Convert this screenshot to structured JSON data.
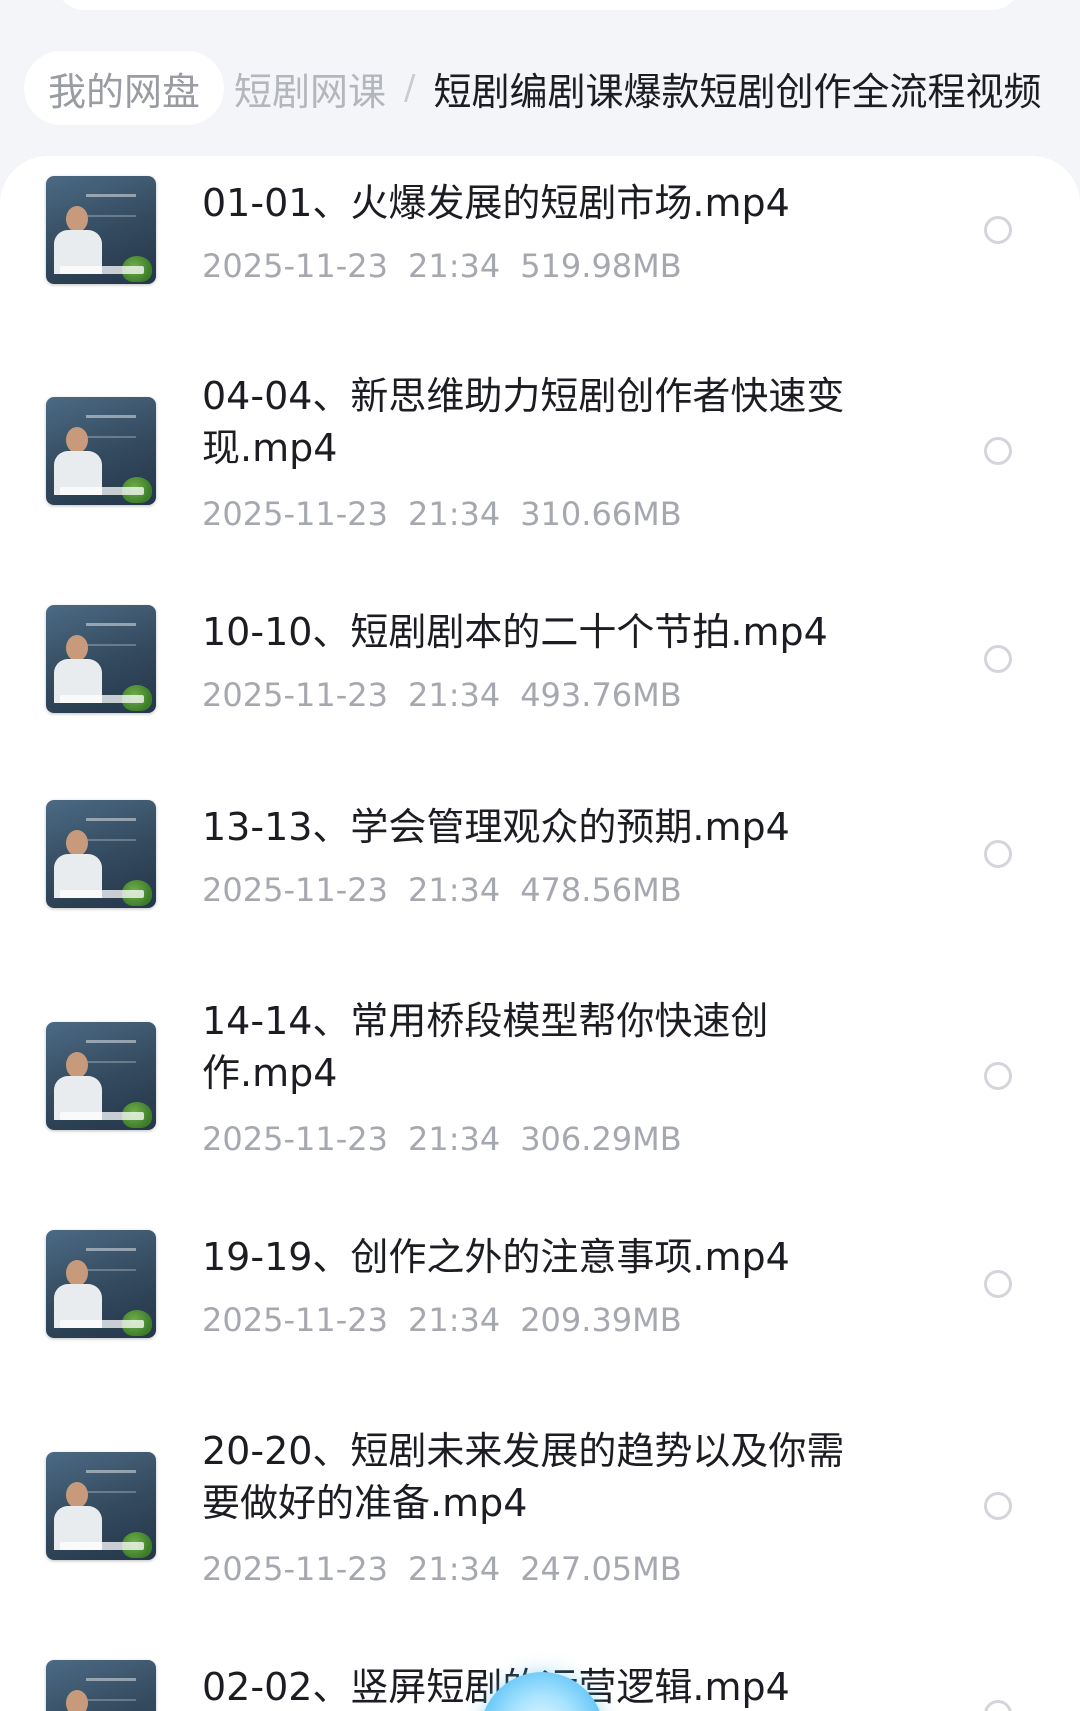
{
  "breadcrumb": {
    "root": "我的网盘",
    "parent": "短剧网课",
    "separator": "/",
    "current": "短剧编剧课爆款短剧创作全流程视频"
  },
  "files": [
    {
      "name": "01-01、火爆发展的短剧市场.mp4",
      "date": "2025-11-23",
      "time": "21:34",
      "size": "519.98MB"
    },
    {
      "name": "04-04、新思维助力短剧创作者快速变现.mp4",
      "date": "2025-11-23",
      "time": "21:34",
      "size": "310.66MB"
    },
    {
      "name": "10-10、短剧剧本的二十个节拍.mp4",
      "date": "2025-11-23",
      "time": "21:34",
      "size": "493.76MB"
    },
    {
      "name": "13-13、学会管理观众的预期.mp4",
      "date": "2025-11-23",
      "time": "21:34",
      "size": "478.56MB"
    },
    {
      "name": "14-14、常用桥段模型帮你快速创作.mp4",
      "date": "2025-11-23",
      "time": "21:34",
      "size": "306.29MB"
    },
    {
      "name": "19-19、创作之外的注意事项.mp4",
      "date": "2025-11-23",
      "time": "21:34",
      "size": "209.39MB"
    },
    {
      "name": "20-20、短剧未来发展的趋势以及你需要做好的准备.mp4",
      "date": "2025-11-23",
      "time": "21:34",
      "size": "247.05MB"
    },
    {
      "name": "02-02、竖屏短剧的运营逻辑.mp4",
      "date": "",
      "time": "",
      "size": ""
    }
  ],
  "icons": {
    "thumbnail": "video-thumbnail",
    "select": "select-circle-icon",
    "floating": "floating-assistant-icon"
  },
  "colors": {
    "background": "#f4f5f8",
    "card": "#ffffff",
    "text_primary": "#1c1d22",
    "text_secondary": "#a6a8af"
  }
}
